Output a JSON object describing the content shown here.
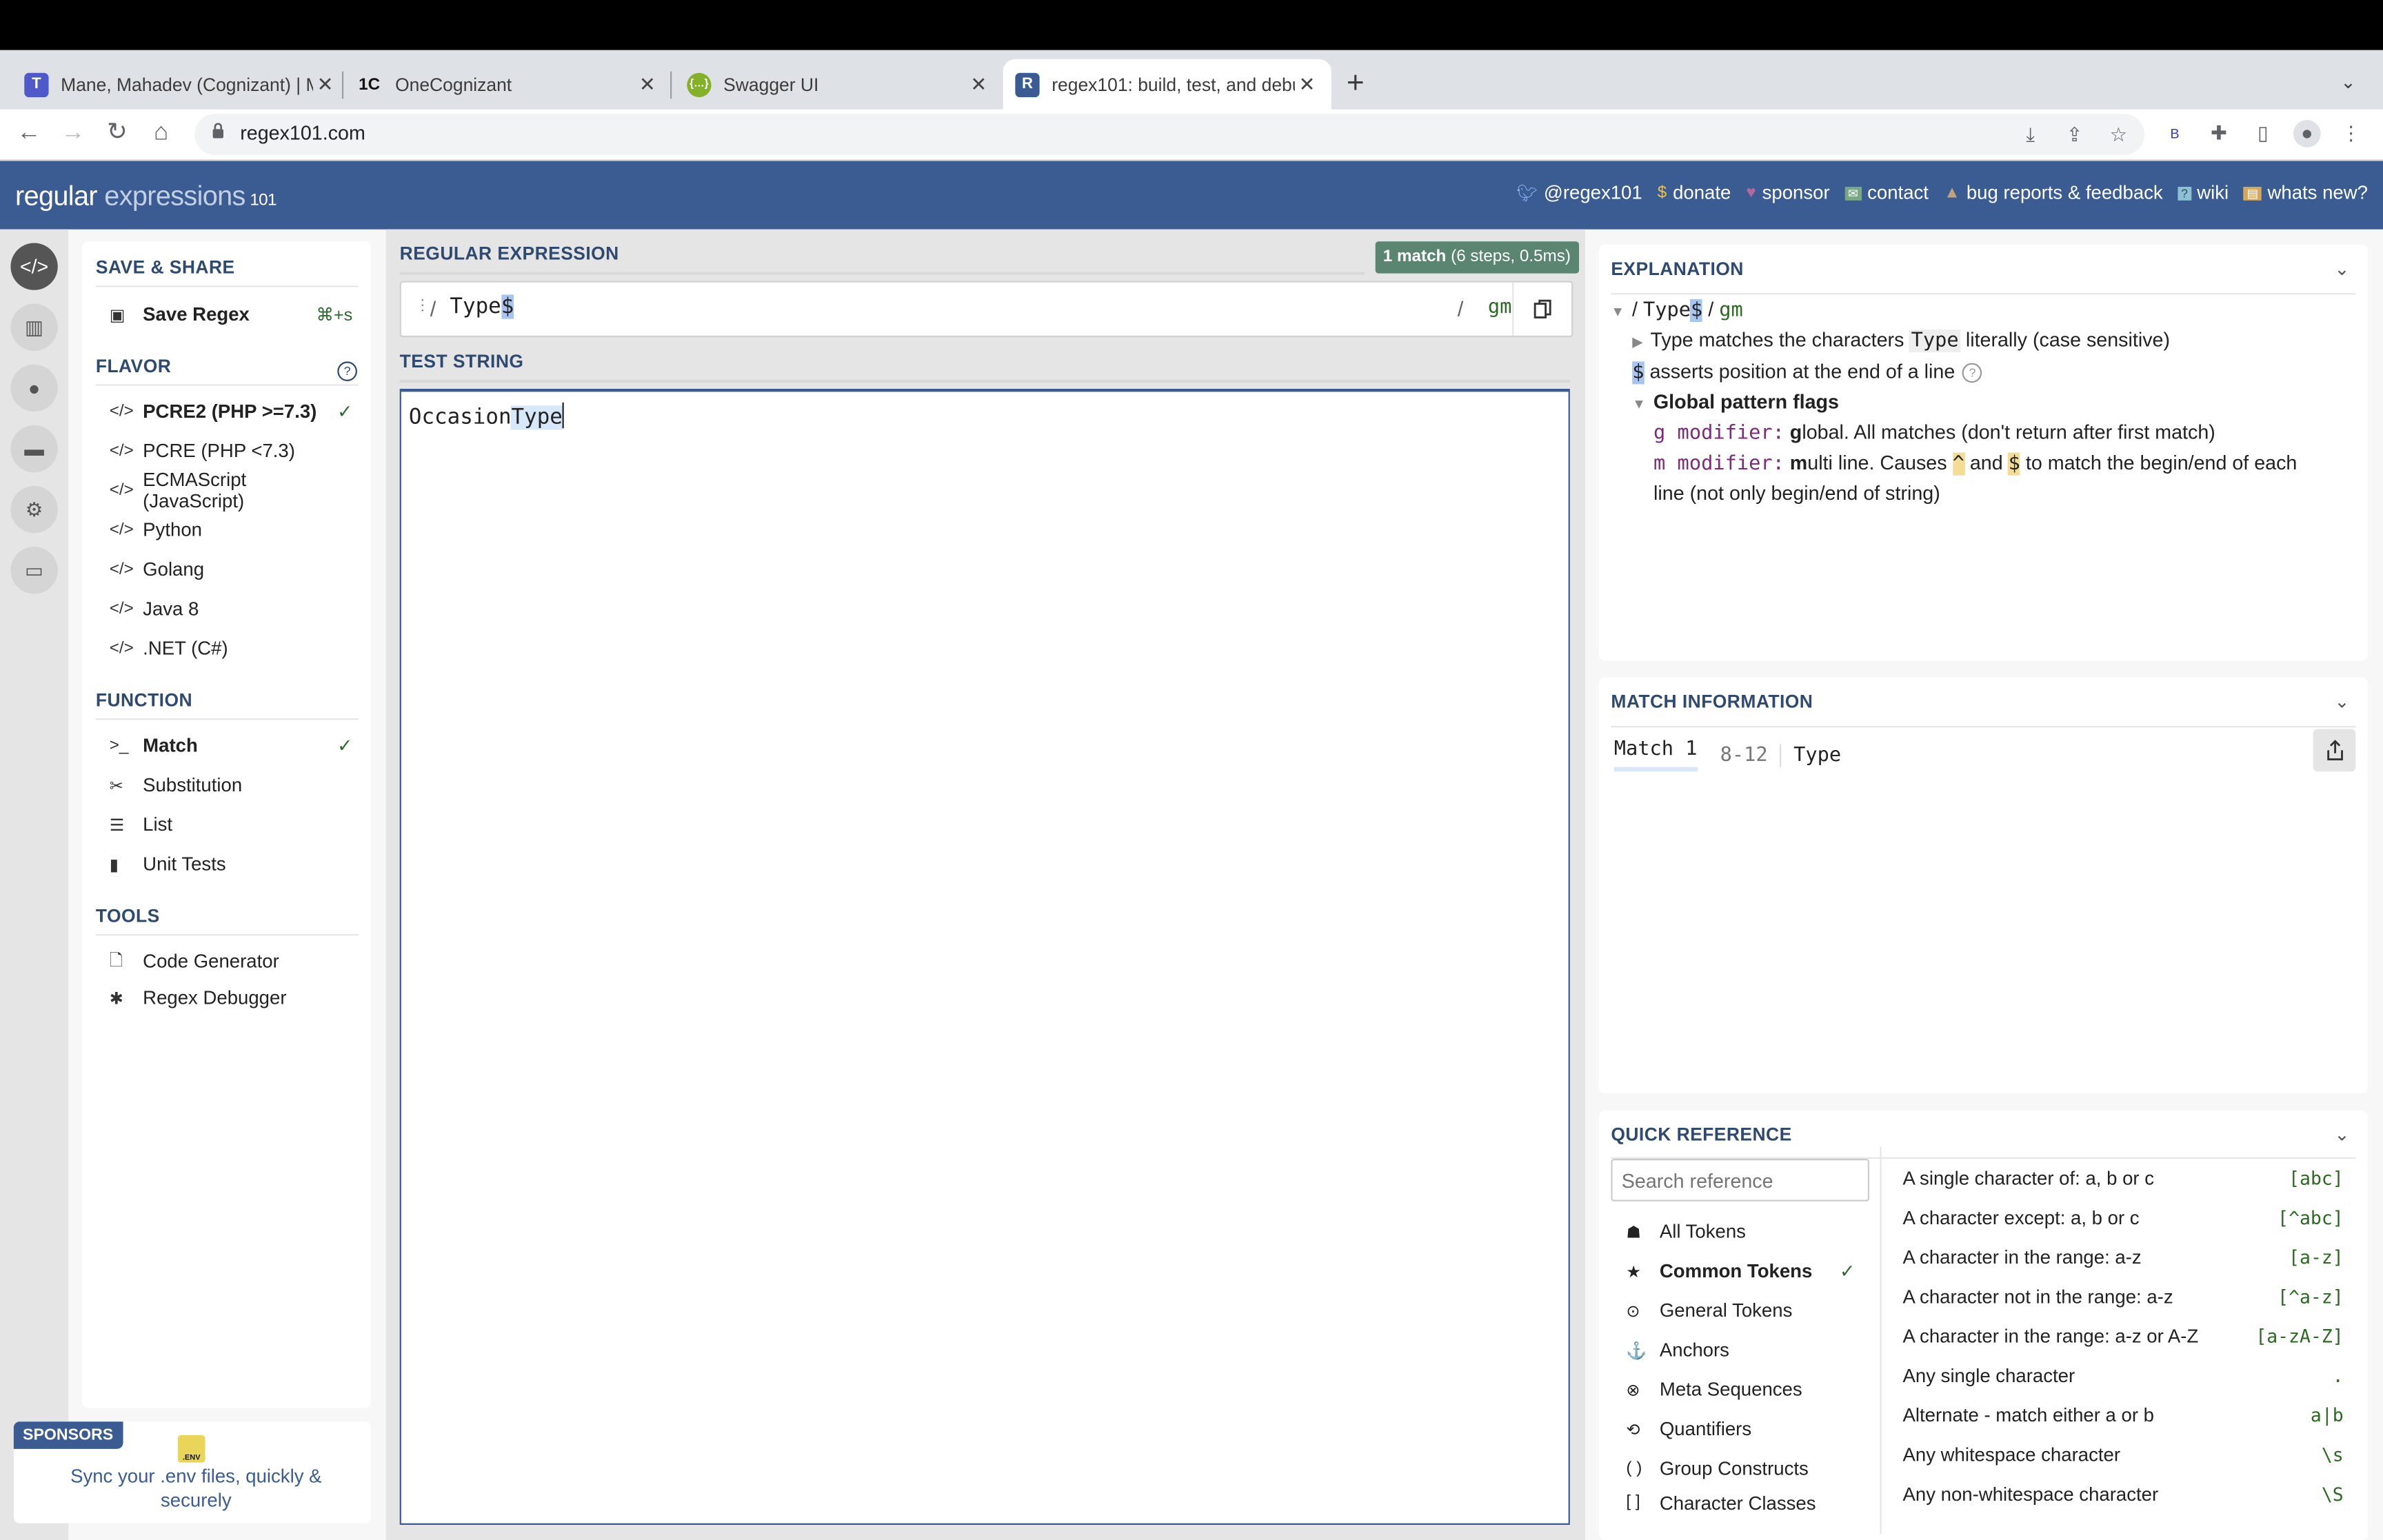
{
  "browser": {
    "tabs": [
      {
        "title": "Mane, Mahadev (Cognizant) | M",
        "favicon": "teams-icon",
        "active": false
      },
      {
        "title": "OneCognizant",
        "favicon": "onecognizant-icon",
        "active": false
      },
      {
        "title": "Swagger UI",
        "favicon": "swagger-icon",
        "active": false
      },
      {
        "title": "regex101: build, test, and debu",
        "favicon": "regex101-icon",
        "active": true
      }
    ],
    "url": "regex101.com",
    "extension_badge": "B"
  },
  "header": {
    "logo": {
      "part1": "regular",
      "part2": "expressions",
      "part3": "101"
    },
    "links": [
      {
        "label": "@regex101",
        "icon": "twitter-icon",
        "color": "#8ab4f8"
      },
      {
        "label": "donate",
        "icon": "dollar-icon",
        "color": "#f0c04c"
      },
      {
        "label": "sponsor",
        "icon": "heart-icon",
        "color": "#b5669c"
      },
      {
        "label": "contact",
        "icon": "mail-icon",
        "color": "#7aa884"
      },
      {
        "label": "bug reports & feedback",
        "icon": "warning-icon",
        "color": "#c2a27a"
      },
      {
        "label": "wiki",
        "icon": "wiki-icon",
        "color": "#8ec0d4"
      },
      {
        "label": "whats new?",
        "icon": "news-icon",
        "color": "#d4a85a"
      }
    ]
  },
  "sidebar": {
    "save_share": {
      "title": "SAVE & SHARE",
      "save_label": "Save Regex",
      "save_shortcut": "⌘+s"
    },
    "flavor": {
      "title": "FLAVOR",
      "items": [
        {
          "label": "PCRE2 (PHP >=7.3)",
          "selected": true
        },
        {
          "label": "PCRE (PHP <7.3)",
          "selected": false
        },
        {
          "label": "ECMAScript (JavaScript)",
          "selected": false
        },
        {
          "label": "Python",
          "selected": false
        },
        {
          "label": "Golang",
          "selected": false
        },
        {
          "label": "Java 8",
          "selected": false
        },
        {
          "label": ".NET (C#)",
          "selected": false
        }
      ]
    },
    "function": {
      "title": "FUNCTION",
      "items": [
        {
          "label": "Match",
          "icon": "terminal-icon",
          "selected": true
        },
        {
          "label": "Substitution",
          "icon": "scissors-icon",
          "selected": false
        },
        {
          "label": "List",
          "icon": "list-settings-icon",
          "selected": false
        },
        {
          "label": "Unit Tests",
          "icon": "test-tube-icon",
          "selected": false
        }
      ]
    },
    "tools": {
      "title": "TOOLS",
      "items": [
        {
          "label": "Code Generator",
          "icon": "code-file-icon"
        },
        {
          "label": "Regex Debugger",
          "icon": "bug-icon"
        }
      ]
    },
    "sponsors": {
      "tag": "SPONSORS",
      "logo_text": ".ENV",
      "text": "Sync your .env files, quickly & securely"
    }
  },
  "editor": {
    "regex_title": "REGULAR EXPRESSION",
    "match_badge": {
      "count": "1 match",
      "detail": "(6 steps, 0.5ms)"
    },
    "regex": {
      "literal": "Type",
      "anchor": "$",
      "delim": "/",
      "flags": "gm"
    },
    "test_title": "TEST STRING",
    "test_string": {
      "before": "Occasion",
      "match": "Type"
    }
  },
  "explanation": {
    "title": "EXPLANATION",
    "root": {
      "delim": "/",
      "literal": "Type",
      "anchor": "$",
      "flags": "gm"
    },
    "lines": {
      "literal": {
        "token": "Type",
        "text1": "matches the characters",
        "code": "Type",
        "text2": "literally (case sensitive)"
      },
      "anchor": {
        "token": "$",
        "text": "asserts position at the end of a line"
      },
      "flags_title": "Global pattern flags",
      "g": {
        "mod": "g modifier:",
        "first": "g",
        "rest": "lobal. All matches (don't return after first match)"
      },
      "m": {
        "mod": "m modifier:",
        "first": "m",
        "rest1": "ulti line. Causes",
        "caret": "^",
        "and": "and",
        "dollar": "$",
        "rest2": "to match the begin/end of each",
        "rest3": "line (not only begin/end of string)"
      }
    }
  },
  "match_info": {
    "title": "MATCH INFORMATION",
    "matches": [
      {
        "label": "Match 1",
        "range": "8-12",
        "value": "Type"
      }
    ]
  },
  "quick_reference": {
    "title": "QUICK REFERENCE",
    "search_placeholder": "Search reference",
    "categories": [
      {
        "label": "All Tokens",
        "icon": "stack-icon",
        "selected": false
      },
      {
        "label": "Common Tokens",
        "icon": "star-icon",
        "selected": true
      },
      {
        "label": "General Tokens",
        "icon": "target-icon",
        "selected": false
      },
      {
        "label": "Anchors",
        "icon": "anchor-icon",
        "selected": false
      },
      {
        "label": "Meta Sequences",
        "icon": "lifebuoy-icon",
        "selected": false
      },
      {
        "label": "Quantifiers",
        "icon": "repeat-icon",
        "selected": false
      },
      {
        "label": "Group Constructs",
        "icon": "parens-icon",
        "selected": false
      },
      {
        "label": "Character Classes",
        "icon": "brackets-icon",
        "selected": false
      }
    ],
    "entries": [
      {
        "desc": "A single character of: a, b or c",
        "token": "[abc]"
      },
      {
        "desc": "A character except: a, b or c",
        "token": "[^abc]"
      },
      {
        "desc": "A character in the range: a-z",
        "token": "[a-z]"
      },
      {
        "desc": "A character not in the range: a-z",
        "token": "[^a-z]"
      },
      {
        "desc": "A character in the range: a-z or A-Z",
        "token": "[a-zA-Z]"
      },
      {
        "desc": "Any single character",
        "token": "."
      },
      {
        "desc": "Alternate - match either a or b",
        "token": "a|b"
      },
      {
        "desc": "Any whitespace character",
        "token": "\\s"
      },
      {
        "desc": "Any non-whitespace character",
        "token": "\\S"
      }
    ]
  }
}
